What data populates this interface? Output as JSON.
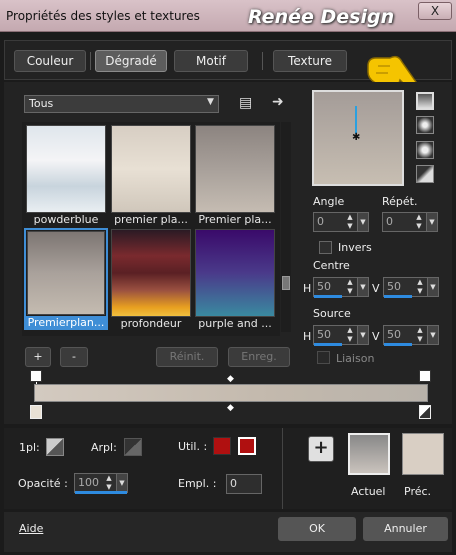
{
  "window": {
    "title": "Propriétés des styles et textures",
    "brand": "Renée Design",
    "close_label": "X"
  },
  "tabs": [
    {
      "label": "Couleur"
    },
    {
      "label": "Dégradé"
    },
    {
      "label": "Motif"
    },
    {
      "label": "Texture"
    }
  ],
  "active_tab": "Dégradé",
  "gallery": {
    "dropdown_value": "Tous",
    "items": [
      {
        "label": "powderblue"
      },
      {
        "label": "premier pla..."
      },
      {
        "label": "Premier pla..."
      },
      {
        "label": "Premierplan..."
      },
      {
        "label": "profondeur"
      },
      {
        "label": "purple and ..."
      }
    ],
    "add_label": "+",
    "remove_label": "-",
    "reset_label": "Réinit.",
    "save_label": "Enreg."
  },
  "props": {
    "angle_label": "Angle",
    "angle_value": "0",
    "repeat_label": "Répét.",
    "repeat_value": "0",
    "invert_label": "Invers",
    "center_label": "Centre",
    "center_h_label": "H",
    "center_h": "50",
    "center_v_label": "V",
    "center_v": "50",
    "source_label": "Source",
    "source_h_label": "H",
    "source_h": "50",
    "source_v_label": "V",
    "source_v": "50",
    "link_label": "Liaison"
  },
  "bottom": {
    "first_label": "1pl:",
    "arpl_label": "Arpl:",
    "util_label": "Util. :",
    "opacity_label": "Opacité :",
    "opacity_value": "100",
    "empl_label": "Empl. :",
    "empl_value": "0",
    "actuel_label": "Actuel",
    "prec_label": "Préc.",
    "add_label": "+"
  },
  "footer": {
    "help_label": "Aide",
    "ok_label": "OK",
    "cancel_label": "Annuler"
  },
  "colors": {
    "accent_blue": "#2e8be0",
    "util_red": "#b01010",
    "selection": "#3f8ed6"
  }
}
